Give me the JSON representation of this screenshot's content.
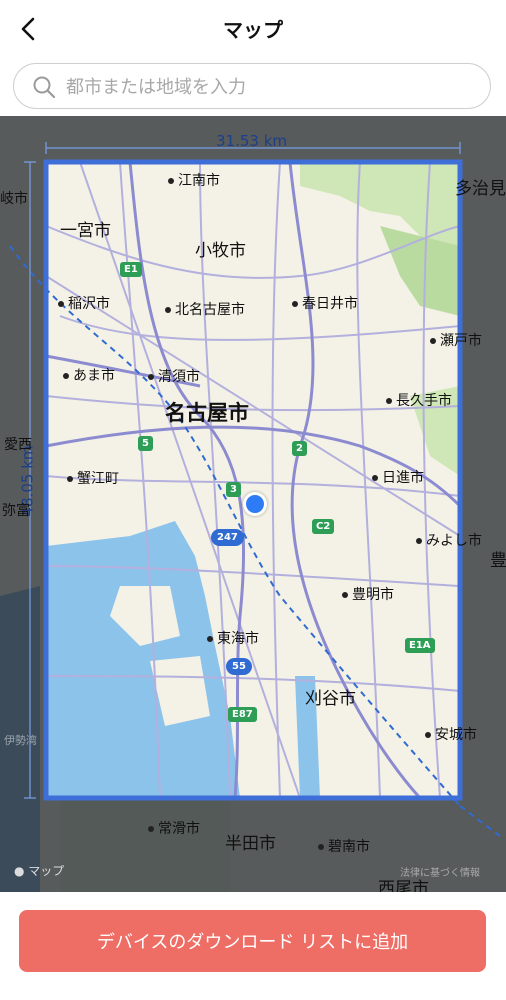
{
  "header": {
    "title": "マップ",
    "back_icon": "chevron-left-icon"
  },
  "search": {
    "placeholder": "都市または地域を入力",
    "icon": "search-icon",
    "value": ""
  },
  "map": {
    "measurement": {
      "width_label": "31.53 km",
      "height_label": "48.05 km"
    },
    "labels": {
      "konan": "江南市",
      "ichinomiya": "一宮市",
      "komaki": "小牧市",
      "inazawa": "稲沢市",
      "kitanagoya": "北名古屋市",
      "kasugai": "春日井市",
      "seto": "瀬戸市",
      "ama": "あま市",
      "kiyosu": "清須市",
      "nagakute": "長久手市",
      "nagoya": "名古屋市",
      "kanie": "蟹江町",
      "nisshin": "日進市",
      "miyoshi": "みよし市",
      "toyoake": "豊明市",
      "tokai": "東海市",
      "kariya": "刈谷市",
      "anjo": "安城市",
      "tokoname": "常滑市",
      "handa": "半田市",
      "hekinan": "碧南市",
      "nishio": "西尾市",
      "tajimi": "多治見",
      "aisai": "愛西",
      "yatomi": "弥富",
      "edge_toyota": "豊",
      "edge_gifu": "岐市",
      "edge_ise": "伊勢湾"
    },
    "shields": {
      "e1": "E1",
      "r5": "5",
      "r2": "2",
      "r3": "3",
      "c2": "C2",
      "r247": "247",
      "e1a": "E1A",
      "r55": "55",
      "e87": "E87"
    },
    "attribution": "マップ",
    "legal": "法律に基づく情報"
  },
  "action_button": {
    "label": "デバイスのダウンロード リストに追加"
  },
  "colors": {
    "accent": "#ee6e65",
    "selection_border": "#3e6fd8",
    "location": "#2d7cf6",
    "water": "#8cc3ea",
    "land": "#f4f2e6"
  }
}
